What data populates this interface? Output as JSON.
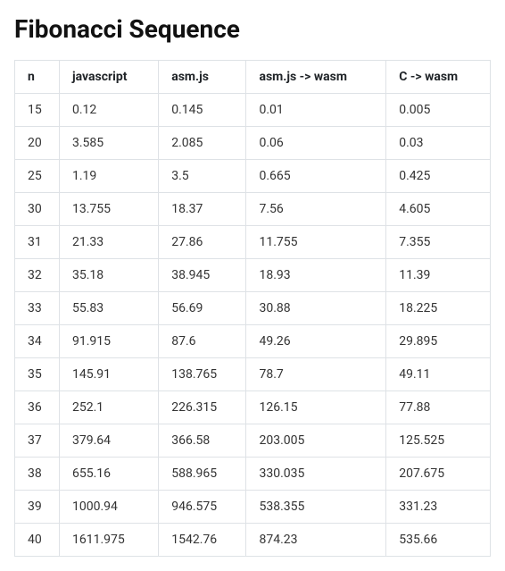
{
  "title": "Fibonacci Sequence",
  "chart_data": {
    "type": "table",
    "columns": [
      "n",
      "javascript",
      "asm.js",
      "asm.js -> wasm",
      "C -> wasm"
    ],
    "rows": [
      [
        15,
        0.12,
        0.145,
        0.01,
        0.005
      ],
      [
        20,
        3.585,
        2.085,
        0.06,
        0.03
      ],
      [
        25,
        1.19,
        3.5,
        0.665,
        0.425
      ],
      [
        30,
        13.755,
        18.37,
        7.56,
        4.605
      ],
      [
        31,
        21.33,
        27.86,
        11.755,
        7.355
      ],
      [
        32,
        35.18,
        38.945,
        18.93,
        11.39
      ],
      [
        33,
        55.83,
        56.69,
        30.88,
        18.225
      ],
      [
        34,
        91.915,
        87.6,
        49.26,
        29.895
      ],
      [
        35,
        145.91,
        138.765,
        78.7,
        49.11
      ],
      [
        36,
        252.1,
        226.315,
        126.15,
        77.88
      ],
      [
        37,
        379.64,
        366.58,
        203.005,
        125.525
      ],
      [
        38,
        655.16,
        588.965,
        330.035,
        207.675
      ],
      [
        39,
        1000.94,
        946.575,
        538.355,
        331.23
      ],
      [
        40,
        1611.975,
        1542.76,
        874.23,
        535.66
      ]
    ]
  }
}
